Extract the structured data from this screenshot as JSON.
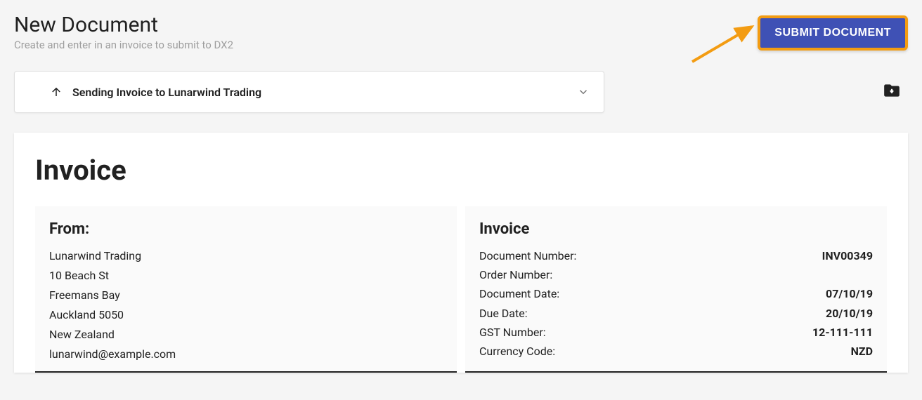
{
  "header": {
    "title": "New Document",
    "subtitle": "Create and enter in an invoice to submit to DX2",
    "submit_label": "SUBMIT DOCUMENT"
  },
  "accordion": {
    "title": "Sending Invoice to Lunarwind Trading"
  },
  "invoice": {
    "heading": "Invoice",
    "from": {
      "heading": "From:",
      "company": "Lunarwind Trading",
      "street": "10 Beach St",
      "suburb": "Freemans Bay",
      "city_postcode": "Auckland 5050",
      "country": "New Zealand",
      "email": "lunarwind@example.com"
    },
    "meta": {
      "heading": "Invoice",
      "rows": [
        {
          "label": "Document Number:",
          "value": "INV00349"
        },
        {
          "label": "Order Number:",
          "value": ""
        },
        {
          "label": "Document Date:",
          "value": "07/10/19"
        },
        {
          "label": "Due Date:",
          "value": "20/10/19"
        },
        {
          "label": "GST Number:",
          "value": "12-111-111"
        },
        {
          "label": "Currency Code:",
          "value": "NZD"
        }
      ]
    }
  }
}
